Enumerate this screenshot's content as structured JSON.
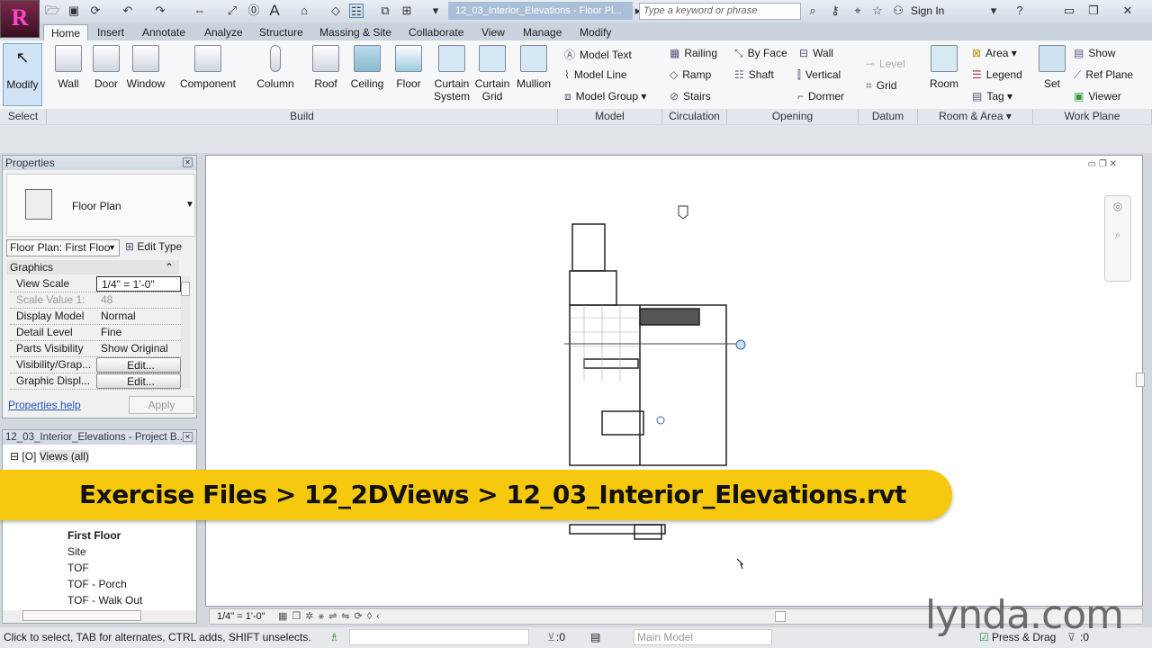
{
  "app": {
    "title": "12_03_Interior_Elevations - Floor Pl...",
    "search_placeholder": "Type a keyword or phrase",
    "sign_in": "Sign In",
    "logo_letter": "R"
  },
  "tabs": [
    "Home",
    "Insert",
    "Annotate",
    "Analyze",
    "Structure",
    "Massing & Site",
    "Collaborate",
    "View",
    "Manage",
    "Modify"
  ],
  "ribbon": {
    "select": {
      "modify": "Modify",
      "label": "Select"
    },
    "build": {
      "items": [
        "Wall",
        "Door",
        "Window",
        "Component",
        "Column",
        "Roof",
        "Ceiling",
        "Floor",
        "Curtain System",
        "Curtain Grid",
        "Mullion"
      ],
      "label": "Build"
    },
    "model": {
      "items": [
        "Model Text",
        "Model Line",
        "Model Group"
      ],
      "label": "Model"
    },
    "circulation": {
      "items": [
        "Railing",
        "Ramp",
        "Stairs"
      ],
      "label": "Circulation"
    },
    "opening": {
      "items": [
        "By Face",
        "Shaft",
        "Wall",
        "Vertical",
        "Dormer"
      ],
      "label": "Opening"
    },
    "datum": {
      "items": [
        "Level",
        "Grid"
      ],
      "label": "Datum"
    },
    "room_area": {
      "room": "Room",
      "items": [
        "Area",
        "Legend",
        "Tag"
      ],
      "label": "Room & Area"
    },
    "work_plane": {
      "set": "Set",
      "items": [
        "Show",
        "Ref Plane",
        "Viewer"
      ],
      "label": "Work Plane"
    }
  },
  "properties": {
    "title": "Properties",
    "type": "Floor Plan",
    "instance": "Floor Plan: First Floo",
    "edit_type": "Edit Type",
    "section": "Graphics",
    "rows": [
      {
        "k": "View Scale",
        "v": "1/4\" = 1'-0\""
      },
      {
        "k": "Scale Value  1:",
        "v": "48"
      },
      {
        "k": "Display Model",
        "v": "Normal"
      },
      {
        "k": "Detail Level",
        "v": "Fine"
      },
      {
        "k": "Parts Visibility",
        "v": "Show Original"
      },
      {
        "k": "Visibility/Grap...",
        "v": "Edit..."
      },
      {
        "k": "Graphic Displ...",
        "v": "Edit..."
      }
    ],
    "help": "Properties help",
    "apply": "Apply"
  },
  "browser": {
    "title": "12_03_Interior_Elevations - Project B...",
    "root": "Views (all)",
    "items": [
      "First Floor",
      "Site",
      "TOF",
      "TOF - Porch",
      "TOF - Walk Out"
    ]
  },
  "view_control": {
    "scale": "1/4\" = 1'-0\""
  },
  "status": {
    "message": "Click to select, TAB for alternates, CTRL adds, SHIFT unselects.",
    "count": ":0",
    "workset": "Main Model",
    "press_drag": "Press & Drag",
    "filter_count": ":0"
  },
  "banner": {
    "text": "Exercise Files > 12_2DViews > 12_03_Interior_Elevations.rvt",
    "color": "#f6c90e"
  },
  "watermark": "lynda.com"
}
